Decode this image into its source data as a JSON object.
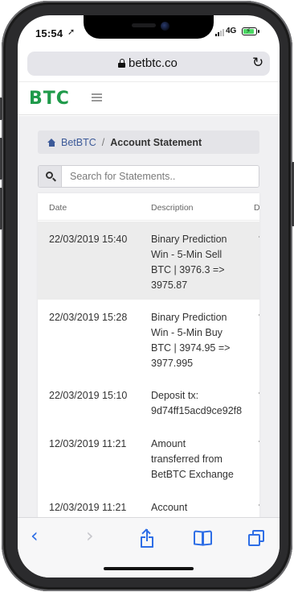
{
  "status": {
    "time": "15:54",
    "network": "4G"
  },
  "browser": {
    "url": "betbtc.co"
  },
  "site": {
    "logo": "BTC"
  },
  "breadcrumb": {
    "home": "BetBTC",
    "separator": "/",
    "current": "Account Statement"
  },
  "search": {
    "placeholder": "Search for Statements.."
  },
  "table": {
    "headers": [
      "Date",
      "Description",
      "D"
    ],
    "rows": [
      {
        "date": "22/03/2019 15:40",
        "description": "Binary Prediction\nWin - 5-Min Sell\nBTC | 3976.3 =>\n3975.87"
      },
      {
        "date": "22/03/2019 15:28",
        "description": "Binary Prediction\nWin - 5-Min Buy\nBTC | 3974.95 =>\n3977.995"
      },
      {
        "date": "22/03/2019 15:10",
        "description": "Deposit tx:\n9d74ff15acd9ce92f8"
      },
      {
        "date": "12/03/2019 11:21",
        "description": "Amount\ntransferred from\nBetBTC Exchange"
      },
      {
        "date": "12/03/2019 11:21",
        "description": "Account\nRegistration"
      }
    ]
  },
  "toolbar": {
    "back": "‹",
    "forward": "›"
  },
  "colors": {
    "brand_green": "#1f9a4a",
    "link_blue": "#3c5a99",
    "ios_blue": "#2e6ee6"
  }
}
